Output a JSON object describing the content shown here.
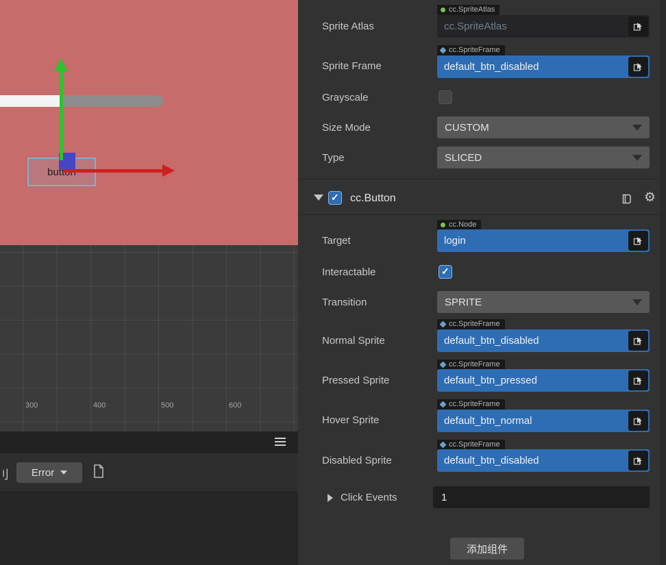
{
  "scene": {
    "node_label": "button"
  },
  "grid": {
    "ruler_labels": [
      "300",
      "400",
      "500",
      "600"
    ]
  },
  "console": {
    "partial_char": "刂",
    "filter_label": "Error"
  },
  "inspector": {
    "rows": {
      "sprite_atlas": {
        "label": "Sprite Atlas",
        "badge": "cc.SpriteAtlas",
        "value": "cc.SpriteAtlas"
      },
      "sprite_frame": {
        "label": "Sprite Frame",
        "badge": "cc.SpriteFrame",
        "value": "default_btn_disabled"
      },
      "grayscale": {
        "label": "Grayscale"
      },
      "size_mode": {
        "label": "Size Mode",
        "value": "CUSTOM"
      },
      "type": {
        "label": "Type",
        "value": "SLICED"
      }
    },
    "button_component": {
      "title": "cc.Button",
      "target": {
        "label": "Target",
        "badge": "cc.Node",
        "value": "login"
      },
      "interactable": {
        "label": "Interactable"
      },
      "transition": {
        "label": "Transition",
        "value": "SPRITE"
      },
      "normal_sprite": {
        "label": "Normal Sprite",
        "badge": "cc.SpriteFrame",
        "value": "default_btn_disabled"
      },
      "pressed_sprite": {
        "label": "Pressed Sprite",
        "badge": "cc.SpriteFrame",
        "value": "default_btn_pressed"
      },
      "hover_sprite": {
        "label": "Hover Sprite",
        "badge": "cc.SpriteFrame",
        "value": "default_btn_normal"
      },
      "disabled_sprite": {
        "label": "Disabled Sprite",
        "badge": "cc.SpriteFrame",
        "value": "default_btn_disabled"
      },
      "click_events": {
        "label": "Click Events",
        "value": "1"
      }
    },
    "add_component_label": "添加组件"
  },
  "colors": {
    "accent_blue": "#2e6db4",
    "scene_background": "#c76b6b",
    "axis_x_red": "#cf1f1f",
    "axis_y_green": "#2ec22e"
  }
}
